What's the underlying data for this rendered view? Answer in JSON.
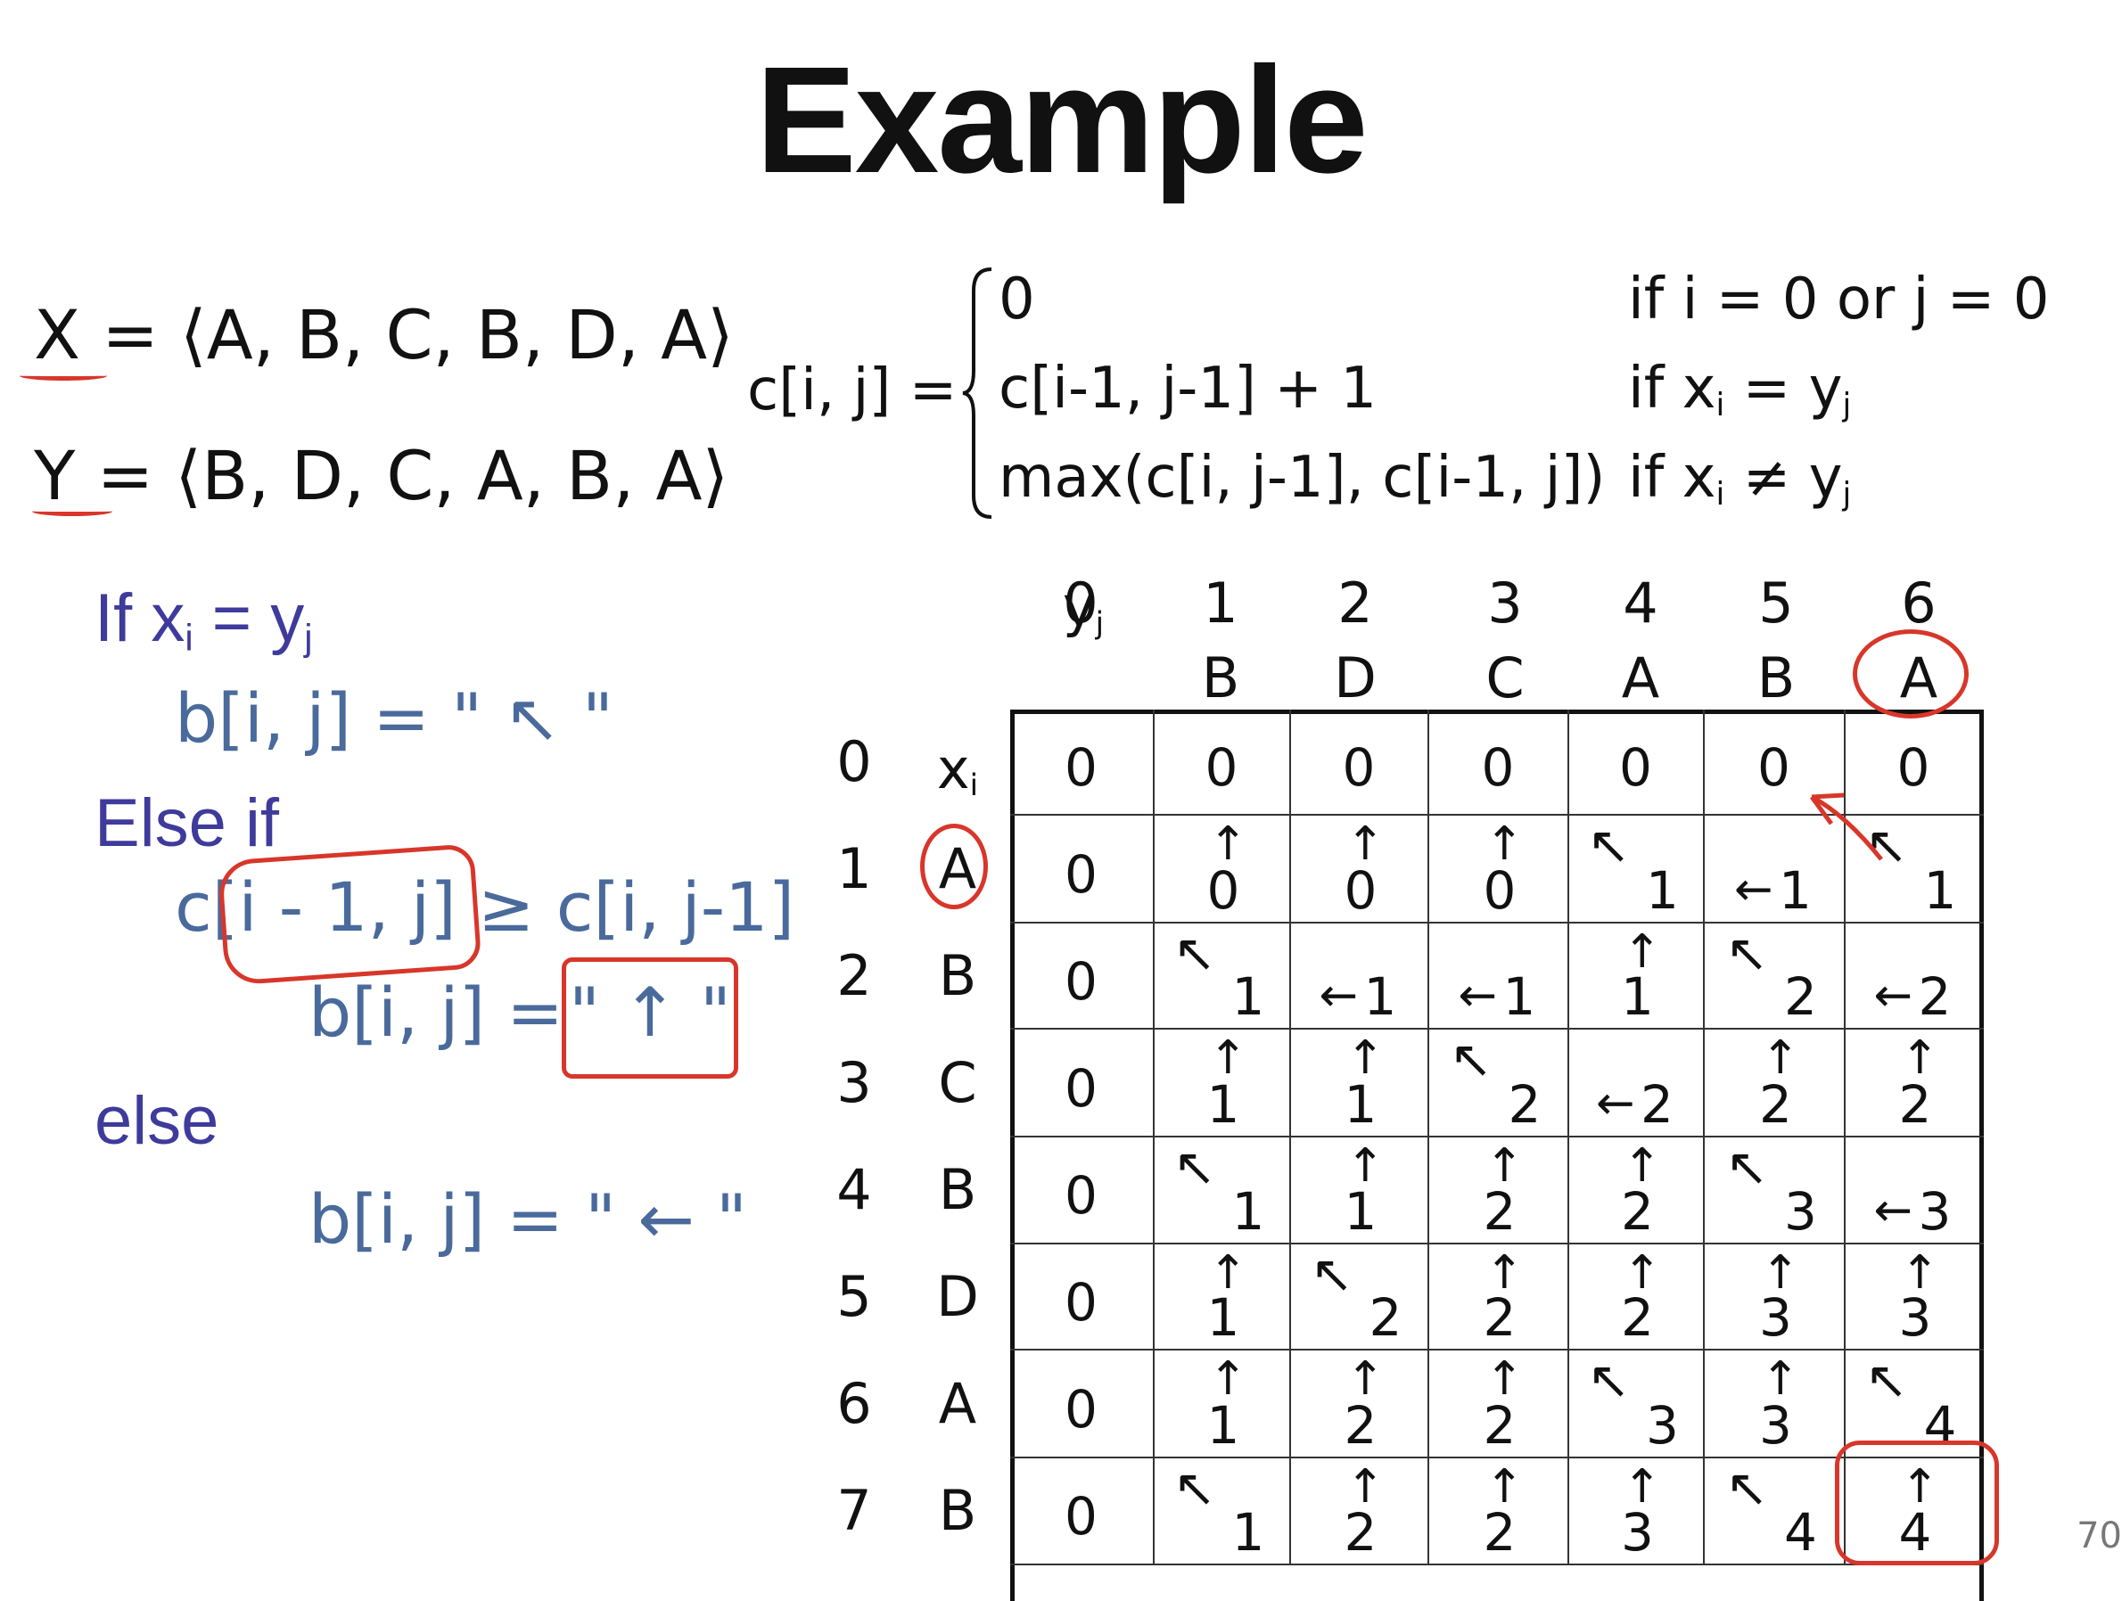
{
  "title": "Example",
  "sequences": {
    "x_line": "X = ⟨A, B, C, B, D, A⟩",
    "y_line": "Y = ⟨B, D, C, A, B, A⟩"
  },
  "recurrence": {
    "lhs": "c[i, j] =",
    "cases": [
      {
        "expr": "0",
        "cond": "if i = 0 or j = 0"
      },
      {
        "expr": "c[i-1, j-1] + 1",
        "cond_pre": "if x",
        "cond_sub1": "i",
        "cond_mid": " = y",
        "cond_sub2": "j"
      },
      {
        "expr": "max(c[i, j-1], c[i-1, j])",
        "cond_pre": "if x",
        "cond_sub1": "i",
        "cond_mid": " ≠ y",
        "cond_sub2": "j"
      }
    ]
  },
  "rules": {
    "if_pre": "If x",
    "if_sub1": "i",
    "if_mid": " = y",
    "if_sub2": "j",
    "b_diag": "b[i, j] = \" ↖ \"",
    "else_if": "Else if",
    "cond": "c[i - 1, j] ≥ c[i, j-1]",
    "b_up_lhs": "b[i, j] =",
    "b_up_rhs": "\" ↑ \"",
    "else": "else",
    "b_left": "b[i, j] = \" ← \""
  },
  "table": {
    "col_indices": [
      "0",
      "1",
      "2",
      "3",
      "4",
      "5",
      "6"
    ],
    "y_label": "y",
    "y_label_sub": "j",
    "y_chars": [
      "B",
      "D",
      "C",
      "A",
      "B",
      "A"
    ],
    "row_indices": [
      "0",
      "1",
      "2",
      "3",
      "4",
      "5",
      "6",
      "7"
    ],
    "x_label": "x",
    "x_label_sub": "i",
    "x_chars": [
      "A",
      "B",
      "C",
      "B",
      "D",
      "A",
      "B"
    ],
    "cells": [
      [
        {
          "v": "0",
          "d": ""
        },
        {
          "v": "0",
          "d": ""
        },
        {
          "v": "0",
          "d": ""
        },
        {
          "v": "0",
          "d": ""
        },
        {
          "v": "0",
          "d": ""
        },
        {
          "v": "0",
          "d": ""
        },
        {
          "v": "0",
          "d": ""
        }
      ],
      [
        {
          "v": "0",
          "d": ""
        },
        {
          "v": "0",
          "d": "up"
        },
        {
          "v": "0",
          "d": "up"
        },
        {
          "v": "0",
          "d": "up"
        },
        {
          "v": "1",
          "d": "diag"
        },
        {
          "v": "1",
          "d": "left"
        },
        {
          "v": "1",
          "d": "diag"
        }
      ],
      [
        {
          "v": "0",
          "d": ""
        },
        {
          "v": "1",
          "d": "diag"
        },
        {
          "v": "1",
          "d": "left"
        },
        {
          "v": "1",
          "d": "left"
        },
        {
          "v": "1",
          "d": "up"
        },
        {
          "v": "2",
          "d": "diag"
        },
        {
          "v": "2",
          "d": "left"
        }
      ],
      [
        {
          "v": "0",
          "d": ""
        },
        {
          "v": "1",
          "d": "up"
        },
        {
          "v": "1",
          "d": "up"
        },
        {
          "v": "2",
          "d": "diag"
        },
        {
          "v": "2",
          "d": "left"
        },
        {
          "v": "2",
          "d": "up"
        },
        {
          "v": "2",
          "d": "up"
        }
      ],
      [
        {
          "v": "0",
          "d": ""
        },
        {
          "v": "1",
          "d": "diag"
        },
        {
          "v": "1",
          "d": "up"
        },
        {
          "v": "2",
          "d": "up"
        },
        {
          "v": "2",
          "d": "up"
        },
        {
          "v": "3",
          "d": "diag"
        },
        {
          "v": "3",
          "d": "left"
        }
      ],
      [
        {
          "v": "0",
          "d": ""
        },
        {
          "v": "1",
          "d": "up"
        },
        {
          "v": "2",
          "d": "diag"
        },
        {
          "v": "2",
          "d": "up"
        },
        {
          "v": "2",
          "d": "up"
        },
        {
          "v": "3",
          "d": "up"
        },
        {
          "v": "3",
          "d": "up"
        }
      ],
      [
        {
          "v": "0",
          "d": ""
        },
        {
          "v": "1",
          "d": "up"
        },
        {
          "v": "2",
          "d": "up"
        },
        {
          "v": "2",
          "d": "up"
        },
        {
          "v": "3",
          "d": "diag"
        },
        {
          "v": "3",
          "d": "up"
        },
        {
          "v": "4",
          "d": "diag"
        }
      ],
      [
        {
          "v": "0",
          "d": ""
        },
        {
          "v": "1",
          "d": "diag"
        },
        {
          "v": "2",
          "d": "up"
        },
        {
          "v": "2",
          "d": "up"
        },
        {
          "v": "3",
          "d": "up"
        },
        {
          "v": "4",
          "d": "diag"
        },
        {
          "v": "4",
          "d": "up"
        }
      ]
    ]
  },
  "page_number": "70",
  "colors": {
    "annotation_red": "#d8362a",
    "blue_text": "#3e3b9c",
    "steel_blue_text": "#4a6a9c"
  }
}
